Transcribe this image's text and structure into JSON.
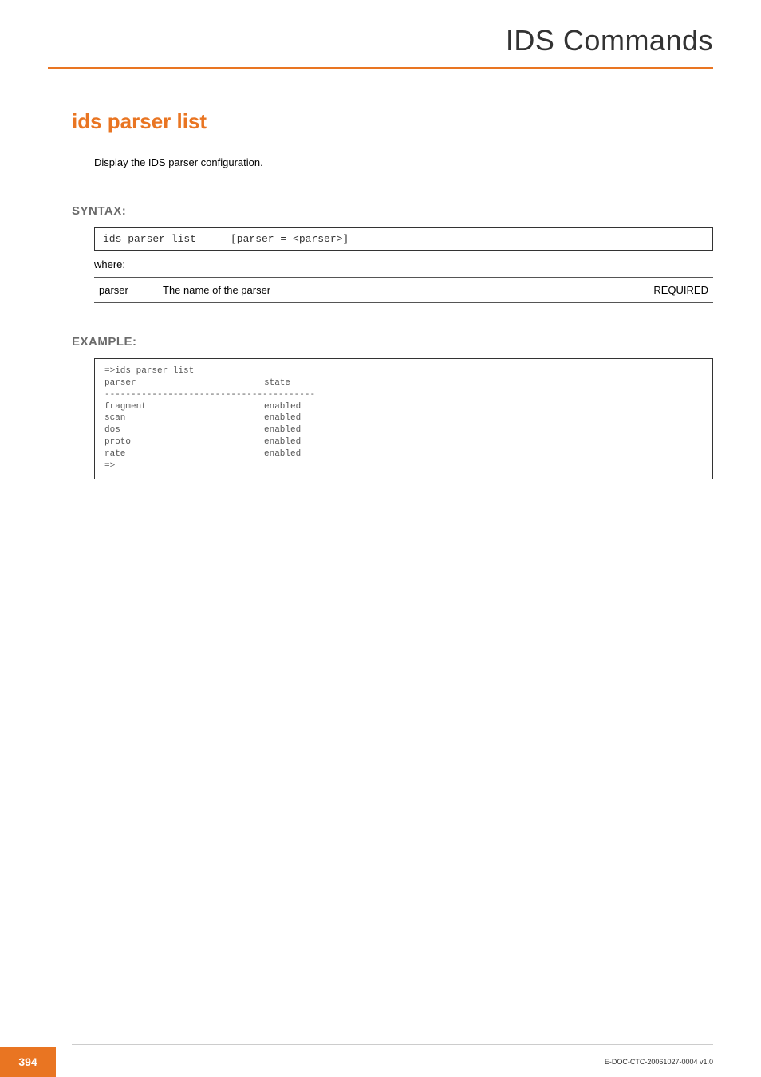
{
  "header": {
    "title": "IDS Commands"
  },
  "section": {
    "title": "ids parser list",
    "description": "Display the IDS parser configuration."
  },
  "syntax": {
    "label": "SYNTAX:",
    "command": "ids parser list",
    "args": "[parser = <parser>]",
    "where": "where:",
    "params": [
      {
        "name": "parser",
        "desc": "The name of the parser",
        "req": "REQUIRED"
      }
    ]
  },
  "example": {
    "label": "EXAMPLE:",
    "prompt": "=>ids parser list",
    "colhead1": "parser",
    "colhead2": "state",
    "divider": "----------------------------------------",
    "rows": [
      {
        "name": "fragment",
        "state": "enabled"
      },
      {
        "name": "scan",
        "state": "enabled"
      },
      {
        "name": "dos",
        "state": "enabled"
      },
      {
        "name": "proto",
        "state": "enabled"
      },
      {
        "name": "rate",
        "state": "enabled"
      }
    ],
    "endprompt": "=>"
  },
  "footer": {
    "page": "394",
    "doc": "E-DOC-CTC-20061027-0004 v1.0"
  }
}
